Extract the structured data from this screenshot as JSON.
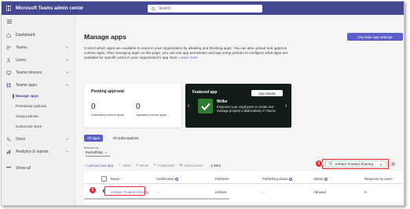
{
  "app": {
    "title": "Microsoft Teams admin center",
    "search_placeholder": "Search"
  },
  "sidebar": {
    "items": [
      {
        "label": "Dashboard",
        "icon": "home-icon"
      },
      {
        "label": "Teams",
        "icon": "teams-icon"
      },
      {
        "label": "Users",
        "icon": "users-icon"
      },
      {
        "label": "Teams devices",
        "icon": "devices-icon"
      },
      {
        "label": "Teams apps",
        "icon": "apps-icon"
      }
    ],
    "sub_items": [
      {
        "label": "Manage apps",
        "active": true
      },
      {
        "label": "Permission policies"
      },
      {
        "label": "Setup policies"
      },
      {
        "label": "Customize store"
      }
    ],
    "bottom_items": [
      {
        "label": "Voice",
        "icon": "phone-icon"
      },
      {
        "label": "Analytics & reports",
        "icon": "analytics-icon"
      },
      {
        "label": "Show all",
        "icon": "ellipsis-icon"
      }
    ]
  },
  "main": {
    "title": "Manage apps",
    "org_button": "Org-wide app settings",
    "intro": "Control which apps are available to users in your organization by allowing and blocking apps. You can also upload and approve custom apps. After managing apps on this page, you can use app permission and app setup policies to configure what apps are available for specific users in your organization's app store.",
    "learn_more": "Learn more",
    "pending": {
      "title": "Pending approval",
      "submitted_count": "0",
      "submitted_label": "Submitted custom apps",
      "updated_count": "0",
      "updated_label": "Updated custom apps"
    },
    "featured": {
      "label": "Featured app",
      "details_button": "App details",
      "app_name": "Wrike",
      "description": "Empower your employees to create and manage projects collaboratively in Teams"
    },
    "tabs": [
      "All apps",
      "All subscriptions"
    ],
    "browse_label": "Browse by",
    "browse_value": "Everything",
    "toolbar": {
      "upload": "Upload new app",
      "allow": "Allow",
      "block": "Block",
      "customize": "Customize",
      "add_to_team": "Add to team",
      "count": "1 item"
    },
    "filter_value": "eShare Trusted Sharing",
    "table": {
      "headers": [
        "Name",
        "Certification",
        "Publisher",
        "Publishing status",
        "Status",
        "Requests by users"
      ],
      "row": {
        "name": "eShare Trusted Sharing",
        "certification": "--",
        "publisher": "eShare",
        "publishing_status": "--",
        "status": "Allowed",
        "requests": "0"
      }
    },
    "callouts": [
      "1",
      "2"
    ]
  },
  "colors": {
    "brand": "#444791",
    "accent": "#5b5fc7",
    "highlight": "#e3282b"
  }
}
